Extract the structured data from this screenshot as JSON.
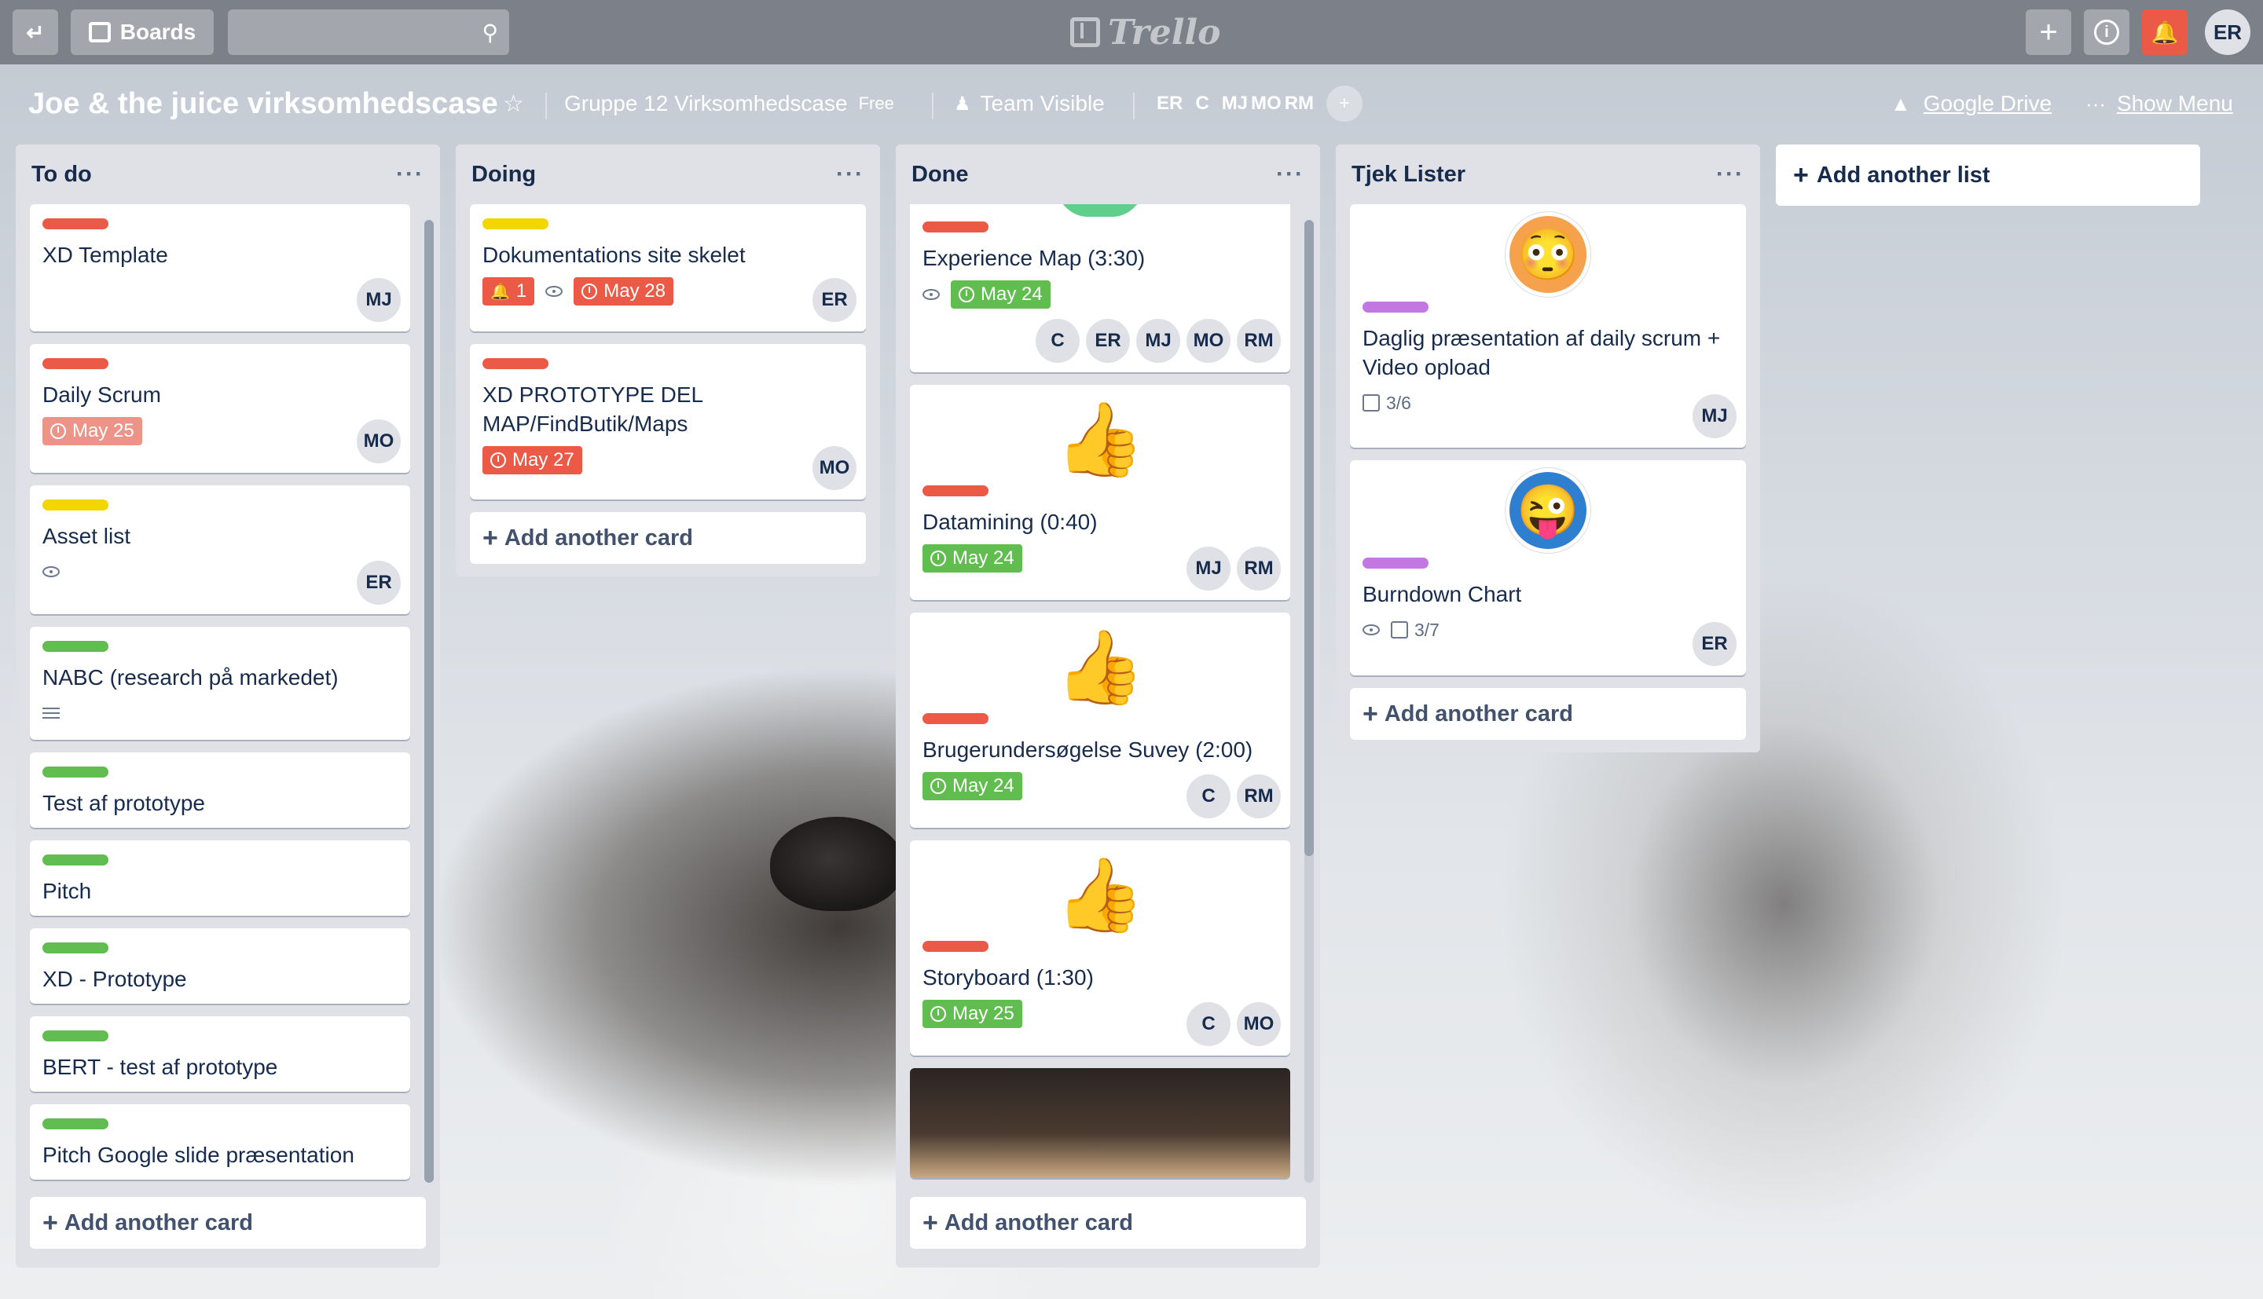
{
  "topbar": {
    "back_icon": "back-arrow-icon",
    "boards_label": "Boards",
    "search_placeholder": "",
    "logo_text": "Trello",
    "user_initials": "ER"
  },
  "board": {
    "title": "Joe & the juice virksomhedscase",
    "team": "Gruppe 12 Virksomhedscase",
    "plan": "Free",
    "visibility": "Team Visible",
    "members": [
      "ER",
      "C",
      "MJ",
      "MO",
      "RM"
    ],
    "google_drive": "Google Drive",
    "show_menu": "Show Menu"
  },
  "colors": {
    "red": "#eb5a46",
    "yellow": "#f2d600",
    "green": "#61bd4f",
    "purple": "#c377e0",
    "notification": "#eb5a46"
  },
  "lists": [
    {
      "title": "To do",
      "add_card": "Add another card",
      "cards": [
        {
          "title": "XD Template",
          "label": "red",
          "members": [
            "MJ"
          ]
        },
        {
          "title": "Daily Scrum",
          "label": "red",
          "due": "May 25",
          "due_color": "#ec9488",
          "members": [
            "MO"
          ]
        },
        {
          "title": "Asset list",
          "label": "yellow",
          "watch": true,
          "members": [
            "ER"
          ]
        },
        {
          "title": "NABC (research på markedet)",
          "label": "green",
          "description": true
        },
        {
          "title": "Test af prototype",
          "label": "green"
        },
        {
          "title": "Pitch",
          "label": "green"
        },
        {
          "title": "XD - Prototype",
          "label": "green"
        },
        {
          "title": "BERT - test af prototype",
          "label": "green"
        },
        {
          "title": "Pitch Google slide præsentation",
          "label": "green"
        }
      ]
    },
    {
      "title": "Doing",
      "add_card": "Add another card",
      "cards": [
        {
          "title": "Dokumentations site skelet",
          "label": "yellow",
          "notifications": "1",
          "watch": true,
          "due": "May 28",
          "due_color": "#eb5a46",
          "members": [
            "ER"
          ]
        },
        {
          "title": "XD PROTOTYPE DEL MAP/FindButik/Maps",
          "label": "red",
          "due": "May 27",
          "due_color": "#eb5a46",
          "members": [
            "MO"
          ]
        }
      ]
    },
    {
      "title": "Done",
      "add_card": "Add another card",
      "cards": [
        {
          "title": "Experience Map (3:30)",
          "label": "red",
          "watch": true,
          "due": "May 24",
          "due_color": "#61bd4f",
          "members": [
            "C",
            "ER",
            "MJ",
            "MO",
            "RM"
          ]
        },
        {
          "title": "Datamining (0:40)",
          "label": "red",
          "due": "May 24",
          "due_color": "#61bd4f",
          "members": [
            "MJ",
            "RM"
          ],
          "sticker": "thumbs-up"
        },
        {
          "title": "Brugerundersøgelse Suvey (2:00)",
          "label": "red",
          "due": "May 24",
          "due_color": "#61bd4f",
          "members": [
            "C",
            "RM"
          ],
          "sticker": "thumbs-up"
        },
        {
          "title": "Storyboard (1:30)",
          "label": "red",
          "due": "May 25",
          "due_color": "#61bd4f",
          "members": [
            "C",
            "MO"
          ],
          "sticker": "thumbs-up"
        }
      ]
    },
    {
      "title": "Tjek Lister",
      "add_card": "Add another card",
      "cards": [
        {
          "title": "Daglig præsentation af daily scrum + Video opload",
          "label": "purple",
          "checklist": "3/6",
          "members": [
            "MJ"
          ],
          "sticker": "surprised-face"
        },
        {
          "title": "Burndown Chart",
          "label": "purple",
          "watch": true,
          "checklist": "3/7",
          "members": [
            "ER"
          ],
          "sticker": "winking-face"
        }
      ]
    }
  ],
  "add_list": "Add another list"
}
